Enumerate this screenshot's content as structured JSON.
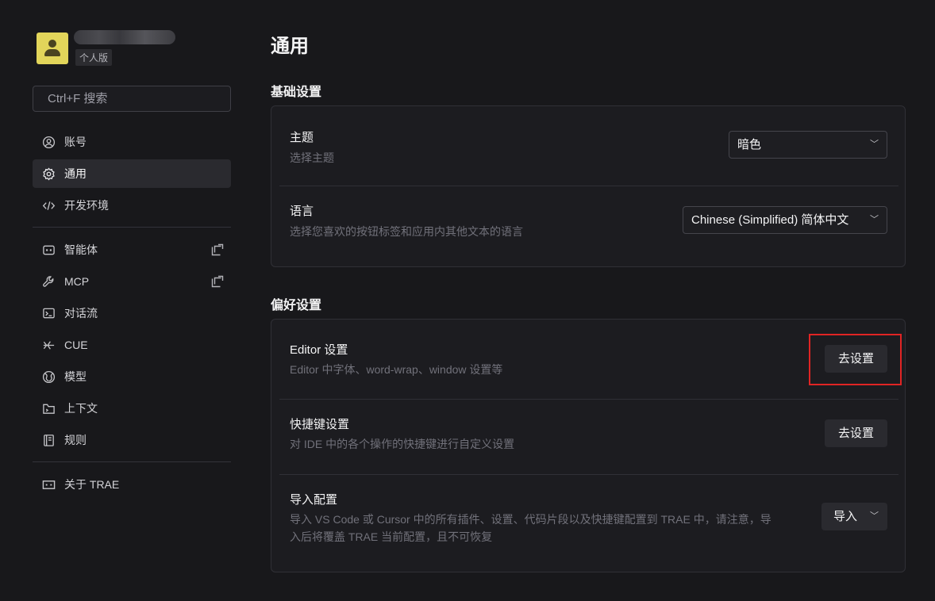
{
  "sidebar": {
    "plan_badge": "个人版",
    "search_placeholder": "Ctrl+F 搜索",
    "items": [
      {
        "label": "账号"
      },
      {
        "label": "通用"
      },
      {
        "label": "开发环境"
      },
      {
        "label": "智能体"
      },
      {
        "label": "MCP"
      },
      {
        "label": "对话流"
      },
      {
        "label": "CUE"
      },
      {
        "label": "模型"
      },
      {
        "label": "上下文"
      },
      {
        "label": "规则"
      },
      {
        "label": "关于 TRAE"
      }
    ]
  },
  "main": {
    "title": "通用",
    "basic": {
      "title": "基础设置",
      "theme": {
        "label": "主题",
        "desc": "选择主题",
        "value": "暗色"
      },
      "language": {
        "label": "语言",
        "desc": "选择您喜欢的按钮标签和应用内其他文本的语言",
        "value": "Chinese (Simplified) 简体中文"
      }
    },
    "prefs": {
      "title": "偏好设置",
      "editor": {
        "label": "Editor 设置",
        "desc": "Editor 中字体、word-wrap、window 设置等",
        "button": "去设置"
      },
      "shortcut": {
        "label": "快捷键设置",
        "desc": "对 IDE 中的各个操作的快捷键进行自定义设置",
        "button": "去设置"
      },
      "import": {
        "label": "导入配置",
        "desc_line1": "导入 VS Code 或 Cursor 中的所有插件、设置、代码片段以及快捷键配置到 TRAE 中，请注意，导",
        "desc_line2": "入后将覆盖 TRAE 当前配置，且不可恢复",
        "button": "导入"
      }
    }
  },
  "colors": {
    "background": "#18181b",
    "card": "#1c1c20",
    "avatar": "#e2d55a",
    "highlight": "#e02424"
  }
}
